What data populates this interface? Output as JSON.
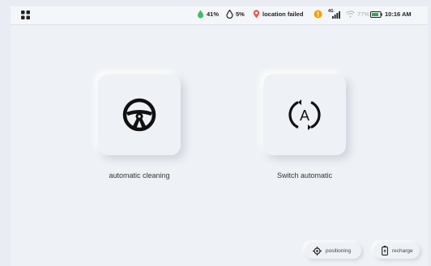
{
  "status": {
    "battery_green": "41%",
    "water": "5%",
    "location": "location failed",
    "network": "4G",
    "wifi_battery": "77%",
    "time": "10:16 AM"
  },
  "cards": [
    {
      "label": "automatic cleaning",
      "icon": "steering-wheel-icon"
    },
    {
      "label": "Switch automatic",
      "icon": "auto-mode-icon"
    }
  ],
  "buttons": {
    "positioning": "positioning",
    "recharge": "recharge"
  },
  "colors": {
    "green": "#3bbf5f",
    "location_red": "#e8574a",
    "warning_orange": "#f5a100",
    "battery_green": "#2fa84f"
  }
}
